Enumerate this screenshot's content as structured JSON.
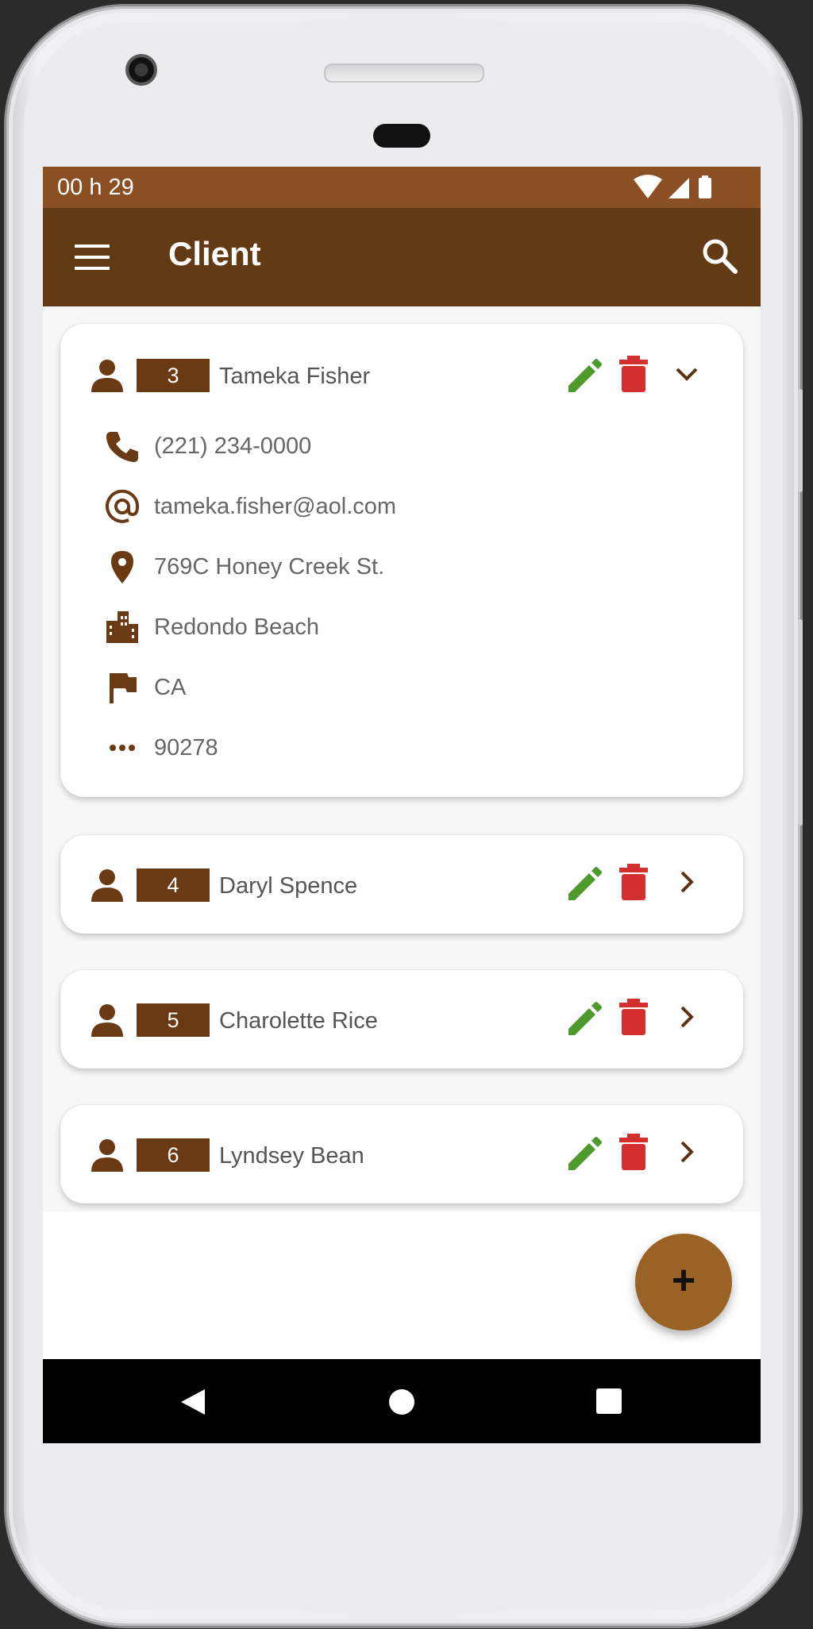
{
  "status_bar": {
    "time": "00 h 29"
  },
  "app_bar": {
    "title": "Client"
  },
  "clients": [
    {
      "id": "3",
      "name": "Tameka Fisher",
      "expanded": true,
      "details": {
        "phone": "(221) 234-0000",
        "email": "tameka.fisher@aol.com",
        "address": "769C Honey Creek St.",
        "city": "Redondo Beach",
        "state": "CA",
        "zip": "90278"
      }
    },
    {
      "id": "4",
      "name": "Daryl Spence",
      "expanded": false
    },
    {
      "id": "5",
      "name": "Charolette Rice",
      "expanded": false
    },
    {
      "id": "6",
      "name": "Lyndsey Bean",
      "expanded": false
    }
  ],
  "fab": {
    "label": "+"
  },
  "colors": {
    "status_bar": "#8a4f22",
    "app_bar": "#623a14",
    "accent_brown": "#6a3a14",
    "edit_green": "#4e9a2c",
    "delete_red": "#d32f2f",
    "fab": "#9a6224"
  },
  "icons": {
    "menu": "menu-icon",
    "search": "search-icon",
    "person": "person-icon",
    "edit": "pencil-icon",
    "delete": "trash-icon",
    "expand": "chevron-icon",
    "phone": "phone-icon",
    "email": "at-sign-icon",
    "address": "map-pin-icon",
    "city": "city-icon",
    "state": "flag-icon",
    "zip": "more-horiz-icon"
  }
}
